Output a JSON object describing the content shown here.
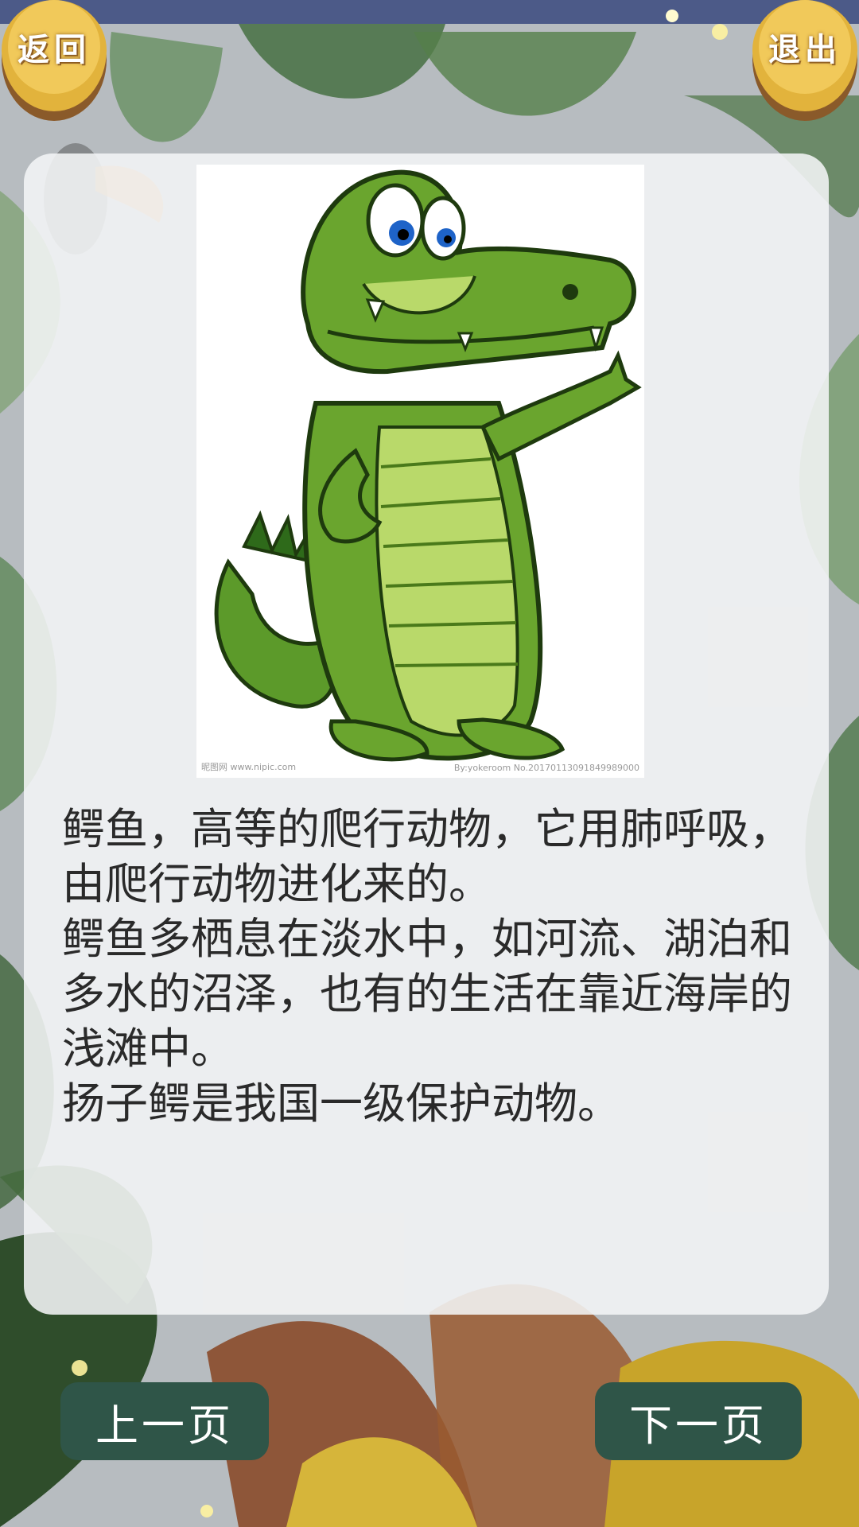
{
  "header": {
    "back_label": "返回",
    "exit_label": "退出"
  },
  "card": {
    "image_watermark_left": "昵图网 www.nipic.com",
    "image_watermark_right": "By:yokeroom No.20170113091849989000",
    "paragraphs": [
      "鳄鱼，高等的爬行动物，它用肺呼吸，由爬行动物进化来的。",
      "鳄鱼多栖息在淡水中，如河流、湖泊和多水的沼泽，也有的生活在靠近海岸的浅滩中。",
      "扬子鳄是我国一级保护动物。"
    ]
  },
  "footer": {
    "prev_label": "上一页",
    "next_label": "下一页"
  },
  "colors": {
    "button_gold": "#f1c95a",
    "nav_button": "#2f5548",
    "card_bg": "#f4f5f6",
    "crocodile_green": "#6aa52e"
  }
}
